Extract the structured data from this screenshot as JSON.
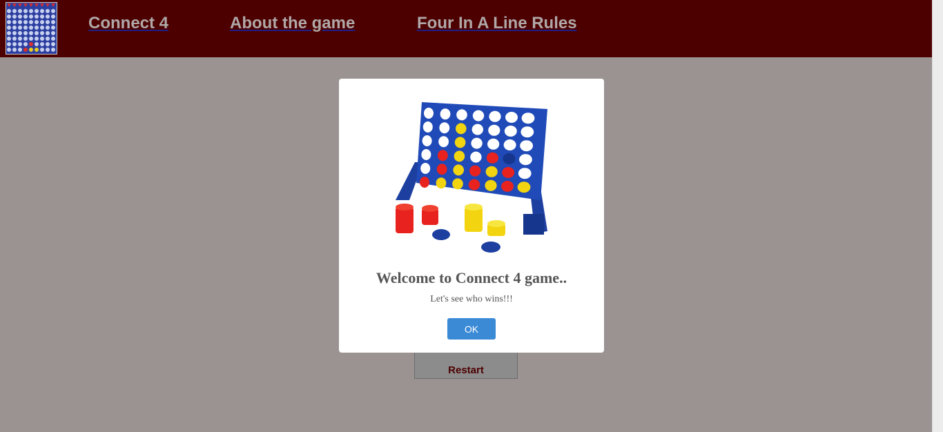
{
  "nav": {
    "links": [
      "Connect 4",
      "About the game",
      "Four In A Line Rules"
    ]
  },
  "game": {
    "restart_label": "Restart"
  },
  "modal": {
    "title": "Welcome to Connect 4 game..",
    "text": "Let's see who wins!!!",
    "ok_label": "OK"
  },
  "colors": {
    "navbar": "#4d0000",
    "background": "#9b9292",
    "board": "#1f4ab8",
    "red_piece": "#e8231f",
    "yellow_piece": "#f2d410",
    "ok_button": "#3a8ad6"
  },
  "icons": [
    "connect4-logo-icon",
    "connect4-board-illustration"
  ]
}
